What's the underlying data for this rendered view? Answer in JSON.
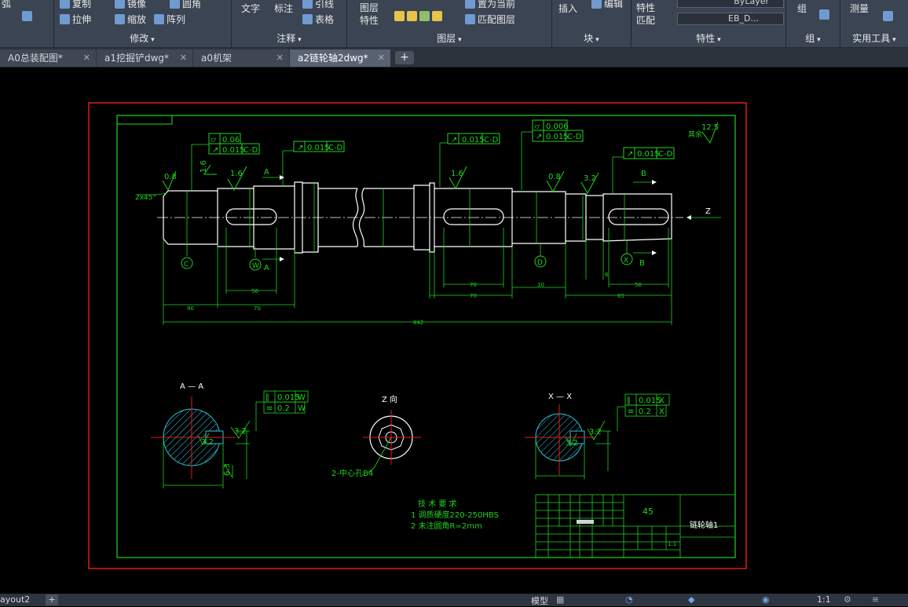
{
  "ribbon": {
    "panels": [
      {
        "title": "修改",
        "items": [
          "复制",
          "镜像",
          "圆角",
          "拉伸",
          "缩放",
          "阵列"
        ]
      },
      {
        "title": "注释",
        "items": [
          "文字",
          "标注",
          "引线",
          "表格"
        ]
      },
      {
        "title": "图层",
        "items": [
          "图层特性",
          "置为当前",
          "匹配图层"
        ]
      },
      {
        "title": "块",
        "items": [
          "插入",
          "编辑"
        ]
      },
      {
        "title": "特性",
        "items": [
          "特性匹配",
          "ByLayer",
          "EB_D..."
        ]
      },
      {
        "title": "组",
        "items": [
          "组"
        ]
      },
      {
        "title": "实用工具",
        "items": [
          "测量"
        ]
      }
    ],
    "arc_label": "弧"
  },
  "tabs": [
    {
      "label": "A0总装配图*"
    },
    {
      "label": "a1挖掘铲dwg*"
    },
    {
      "label": "a0机架"
    },
    {
      "label": "a2链轮轴2dwg*"
    }
  ],
  "drawing": {
    "tolerances": {
      "t1": "0.06",
      "t2": "0.015",
      "t2ref": "C-D",
      "t3": "0.015",
      "t3ref": "C-D",
      "t4": "0.015",
      "t4ref": "C-D",
      "t5": "0.006",
      "t6": "0.015",
      "t6ref": "C-D",
      "t7": "0.015",
      "t7ref": "C-D",
      "sa1": "0.015",
      "sa1ref": "W",
      "sa2": "0.2",
      "sa2ref": "W",
      "sx1": "0.015",
      "sx1ref": "X",
      "sx2": "0.2",
      "sx2ref": "X"
    },
    "roughness": [
      "0.8",
      "1.6",
      "1.6",
      "1.6",
      "0.8",
      "3.2",
      "3.2",
      "3.2",
      "6.3",
      "12.5"
    ],
    "other_roughness_label": "其余",
    "chamfer": "2x45°",
    "section_labels": {
      "a": "A",
      "b": "B",
      "datum_c": "C",
      "datum_w": "W",
      "datum_d": "D",
      "datum_x": "X"
    },
    "dims": {
      "d1": "90",
      "d2": "70",
      "d3": "56",
      "d4": "70",
      "d5": "30",
      "d6": "65",
      "total": "842",
      "d7": "6"
    },
    "section_aa_title": "A — A",
    "section_xx_title": "X — X",
    "view_z_title": "Z  向",
    "center_hole_note": "2-中心孔B4",
    "axis_z": "Z",
    "tech_title": "技 术 要 求",
    "tech_reqs": [
      "1  调质硬度220-250HBS",
      "2  未注圆角R=2mm"
    ],
    "title_block": {
      "material": "45",
      "part_name": "链轮轴1",
      "scale": "1:1"
    }
  },
  "status": {
    "layout_tab": "ayout2",
    "model_label": "模型",
    "scale": "1:1"
  }
}
